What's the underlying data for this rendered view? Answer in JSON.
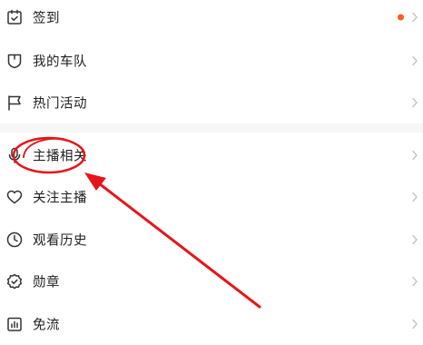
{
  "menu": {
    "items": [
      {
        "label": "签到",
        "icon": "calendar-check-icon",
        "has_badge": true
      },
      {
        "label": "我的车队",
        "icon": "shield-icon"
      },
      {
        "label": "热门活动",
        "icon": "flag-icon"
      },
      {
        "label": "主播相关",
        "icon": "microphone-icon"
      },
      {
        "label": "关注主播",
        "icon": "heart-icon"
      },
      {
        "label": "观看历史",
        "icon": "clock-icon"
      },
      {
        "label": "勋章",
        "icon": "badge-icon"
      },
      {
        "label": "免流",
        "icon": "data-chart-icon"
      }
    ]
  },
  "colors": {
    "badge": "#ff5a1f",
    "annotation": "#e5161b",
    "chevron": "#c4c4c4",
    "divider": "#f7f7f7",
    "icon": "#333333"
  },
  "annotation": {
    "highlight_target": "主播相关",
    "shapes": [
      "circle",
      "arrow"
    ]
  }
}
